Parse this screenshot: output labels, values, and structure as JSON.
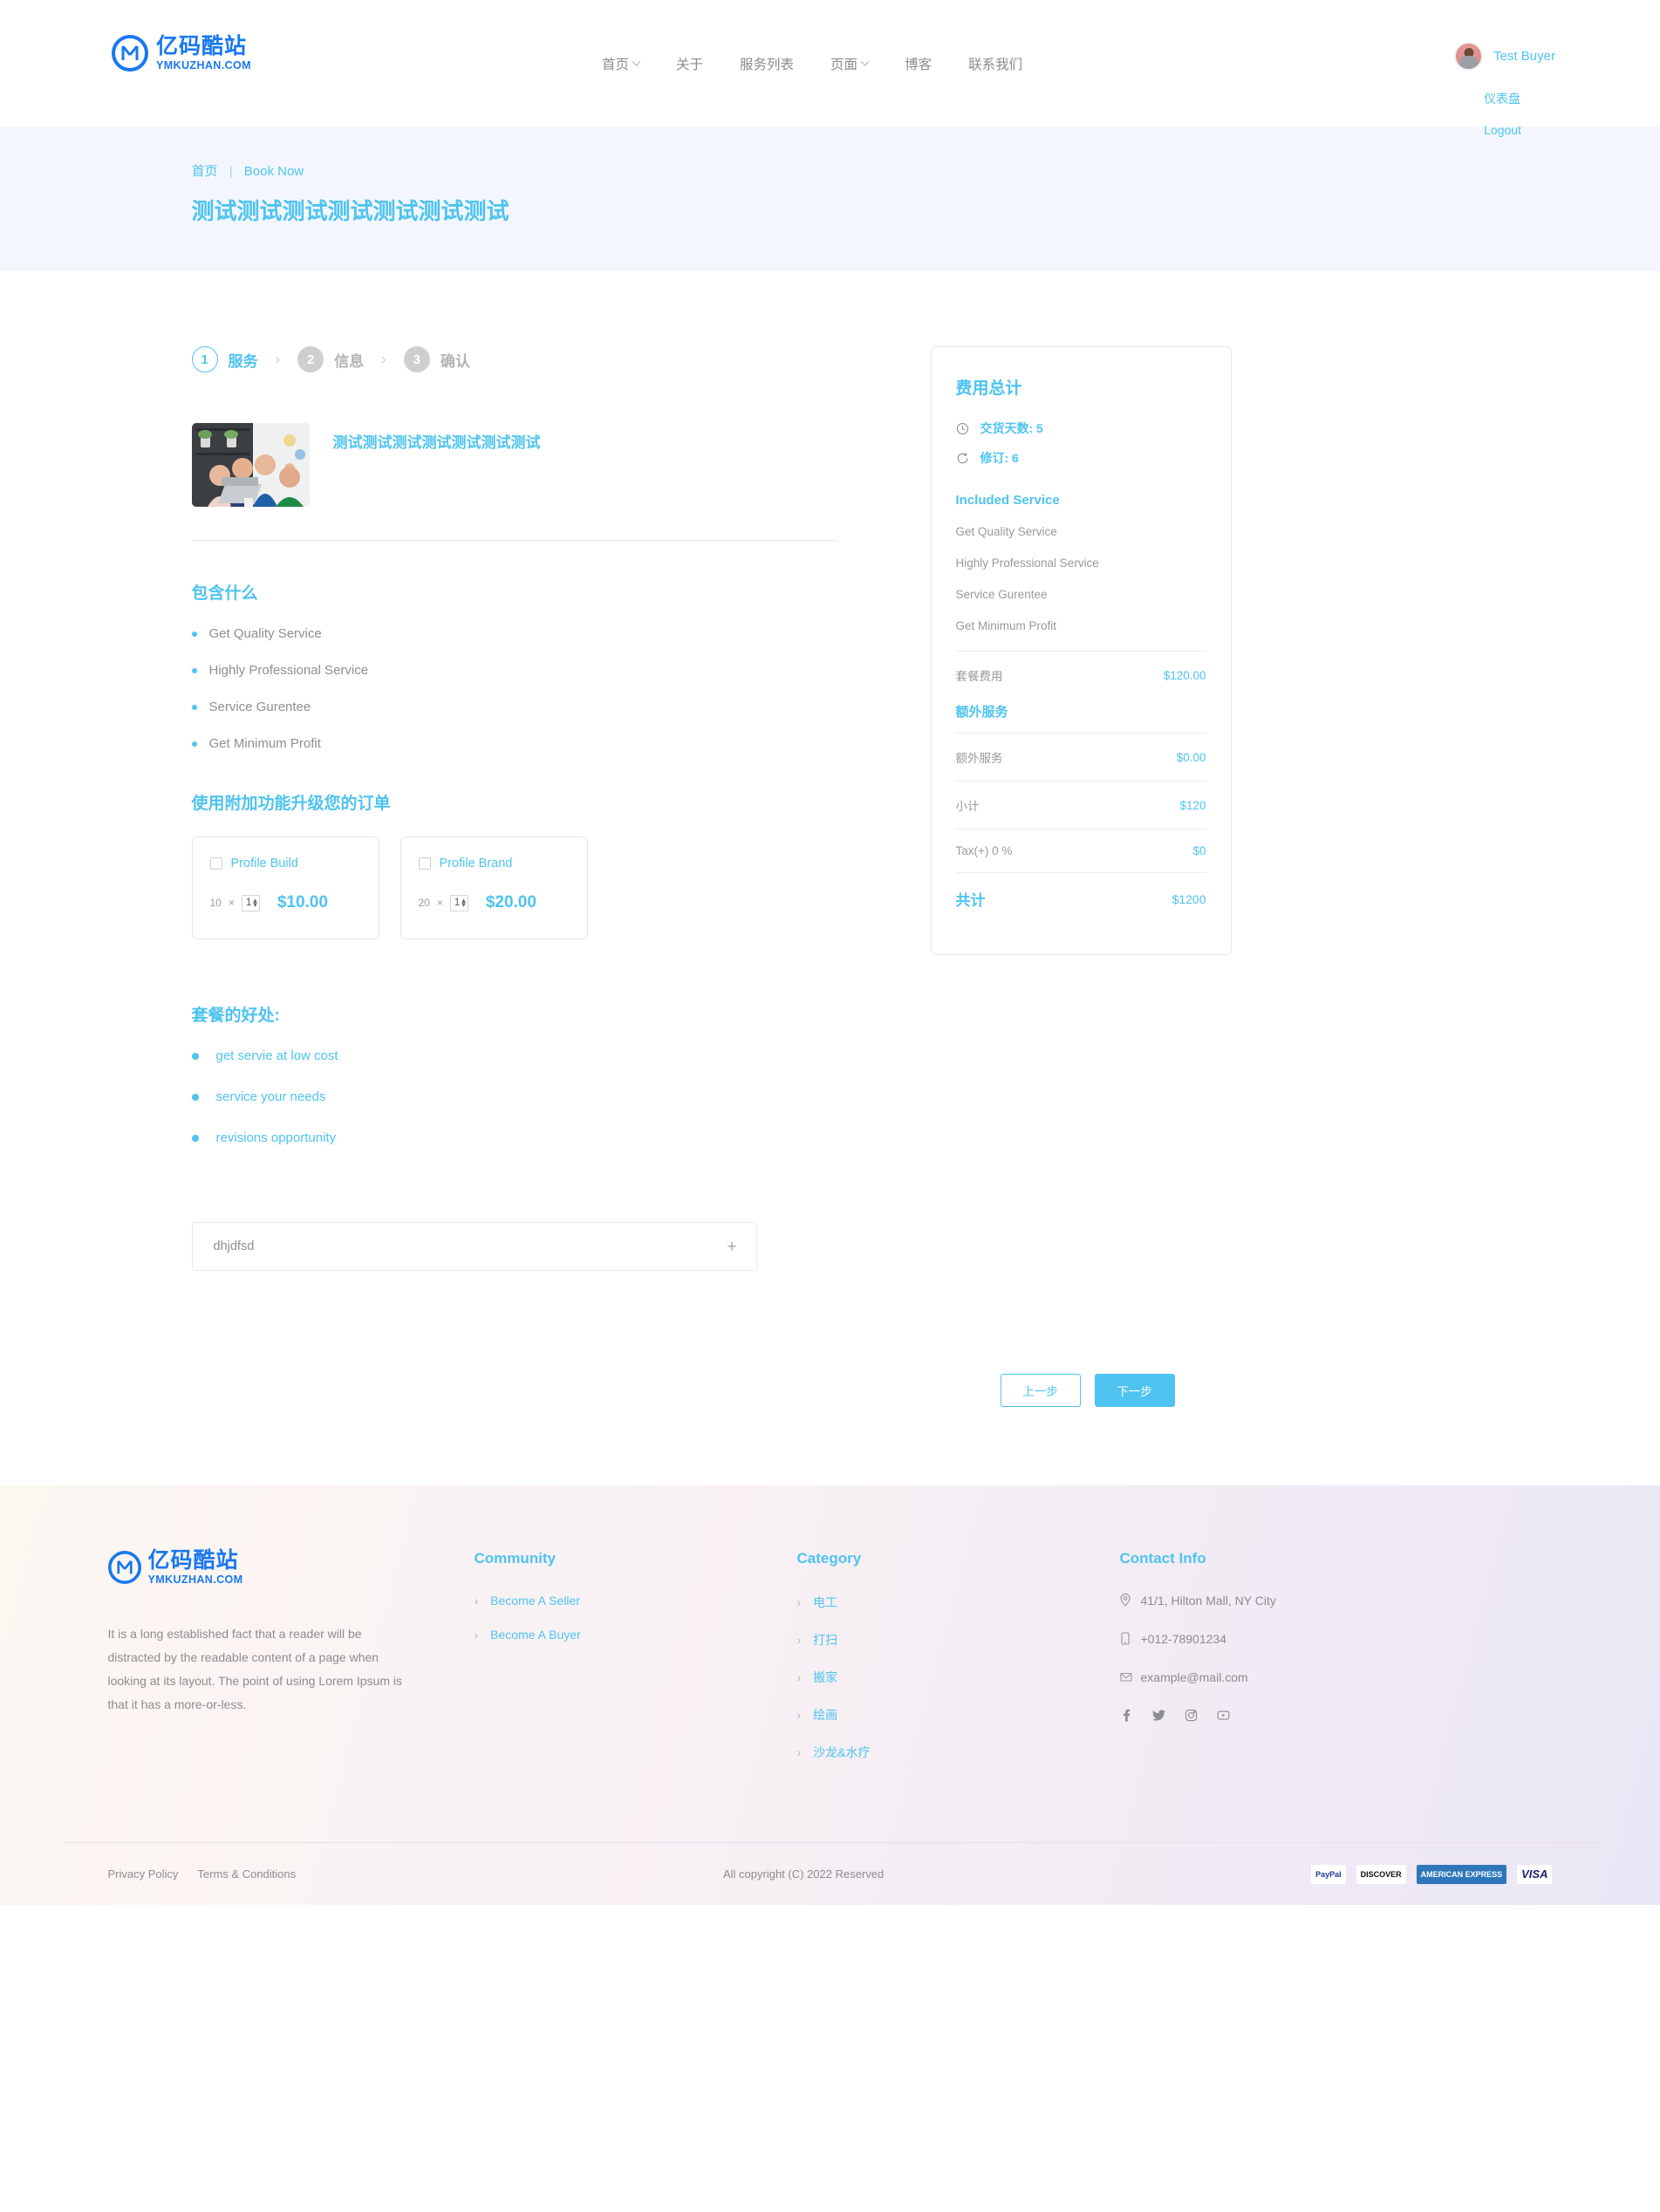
{
  "header": {
    "logo": {
      "cn": "亿码酷站",
      "en": "YMKUZHAN.COM"
    },
    "nav": [
      {
        "label": "首页",
        "caret": true
      },
      {
        "label": "关于",
        "caret": false
      },
      {
        "label": "服务列表",
        "caret": false
      },
      {
        "label": "页面",
        "caret": true
      },
      {
        "label": "博客",
        "caret": false
      },
      {
        "label": "联系我们",
        "caret": false
      }
    ],
    "user": {
      "name": "Test Buyer",
      "menu": [
        "仪表盘",
        "Logout"
      ]
    }
  },
  "banner": {
    "crumb_home": "首页",
    "crumb_sep": "|",
    "crumb_current": "Book Now",
    "title": "测试测试测试测试测试测试测试"
  },
  "steps": [
    {
      "num": "1",
      "label": "服务",
      "state": "active"
    },
    {
      "num": "2",
      "label": "信息",
      "state": "idle"
    },
    {
      "num": "3",
      "label": "确认",
      "state": "idle"
    }
  ],
  "service": {
    "title": "测试测试测试测试测试测试测试"
  },
  "includes": {
    "title": "包含什么",
    "items": [
      "Get Quality Service",
      "Highly Professional Service",
      "Service Gurentee",
      "Get Minimum Profit"
    ]
  },
  "addons": {
    "title": "使用附加功能升级您的订单",
    "items": [
      {
        "name": "Profile Build",
        "unit": "10",
        "times": "×",
        "qty": "1",
        "price": "$10.00"
      },
      {
        "name": "Profile Brand",
        "unit": "20",
        "times": "×",
        "qty": "1",
        "price": "$20.00"
      }
    ]
  },
  "benefits": {
    "title": "套餐的好处:",
    "items": [
      "get servie at low cost",
      "service your needs",
      "revisions opportunity"
    ]
  },
  "accordion": {
    "label": "dhjdfsd",
    "toggle": "+"
  },
  "summary": {
    "title": "费用总计",
    "delivery": "交货天数: 5",
    "revision": "修订: 6",
    "included_title": "Included Service",
    "included": [
      "Get Quality Service",
      "Highly Professional Service",
      "Service Gurentee",
      "Get Minimum Profit"
    ],
    "package_label": "套餐费用",
    "package_value": "$120.00",
    "extra_title": "额外服务",
    "extra_label": "额外服务",
    "extra_value": "$0.00",
    "subtotal_label": "小计",
    "subtotal_value": "$120",
    "tax_label": "Tax(+) 0 %",
    "tax_value": "$0",
    "total_label": "共计",
    "total_value": "$1200"
  },
  "actions": {
    "prev": "上一步",
    "next": "下一步"
  },
  "footer": {
    "logo": {
      "cn": "亿码酷站",
      "en": "YMKUZHAN.COM"
    },
    "desc": "It is a long established fact that a reader will be distracted by the readable content of a page when looking at its layout. The point of using Lorem Ipsum is that it has a more-or-less.",
    "community": {
      "title": "Community",
      "links": [
        "Become A Seller",
        "Become A Buyer"
      ]
    },
    "category": {
      "title": "Category",
      "links": [
        "电工",
        "打扫",
        "搬家",
        "绘画",
        "沙龙&水疗"
      ]
    },
    "contact": {
      "title": "Contact Info",
      "address": "41/1, Hilton Mall, NY City",
      "phone": "+012-78901234",
      "email": "example@mail.com",
      "social": [
        "facebook-icon",
        "twitter-icon",
        "instagram-icon",
        "youtube-icon"
      ]
    },
    "bottom": {
      "privacy": "Privacy Policy",
      "terms": "Terms & Conditions",
      "copyright": "All copyright (C) 2022 Reserved",
      "payments": [
        "PayPal",
        "DISCOVER",
        "AMERICAN EXPRESS",
        "VISA"
      ]
    }
  },
  "colors": {
    "accent": "#4ec3f0",
    "brand": "#1878f0",
    "banner_bg": "#f3f7fd",
    "muted": "#8f8f8f"
  }
}
